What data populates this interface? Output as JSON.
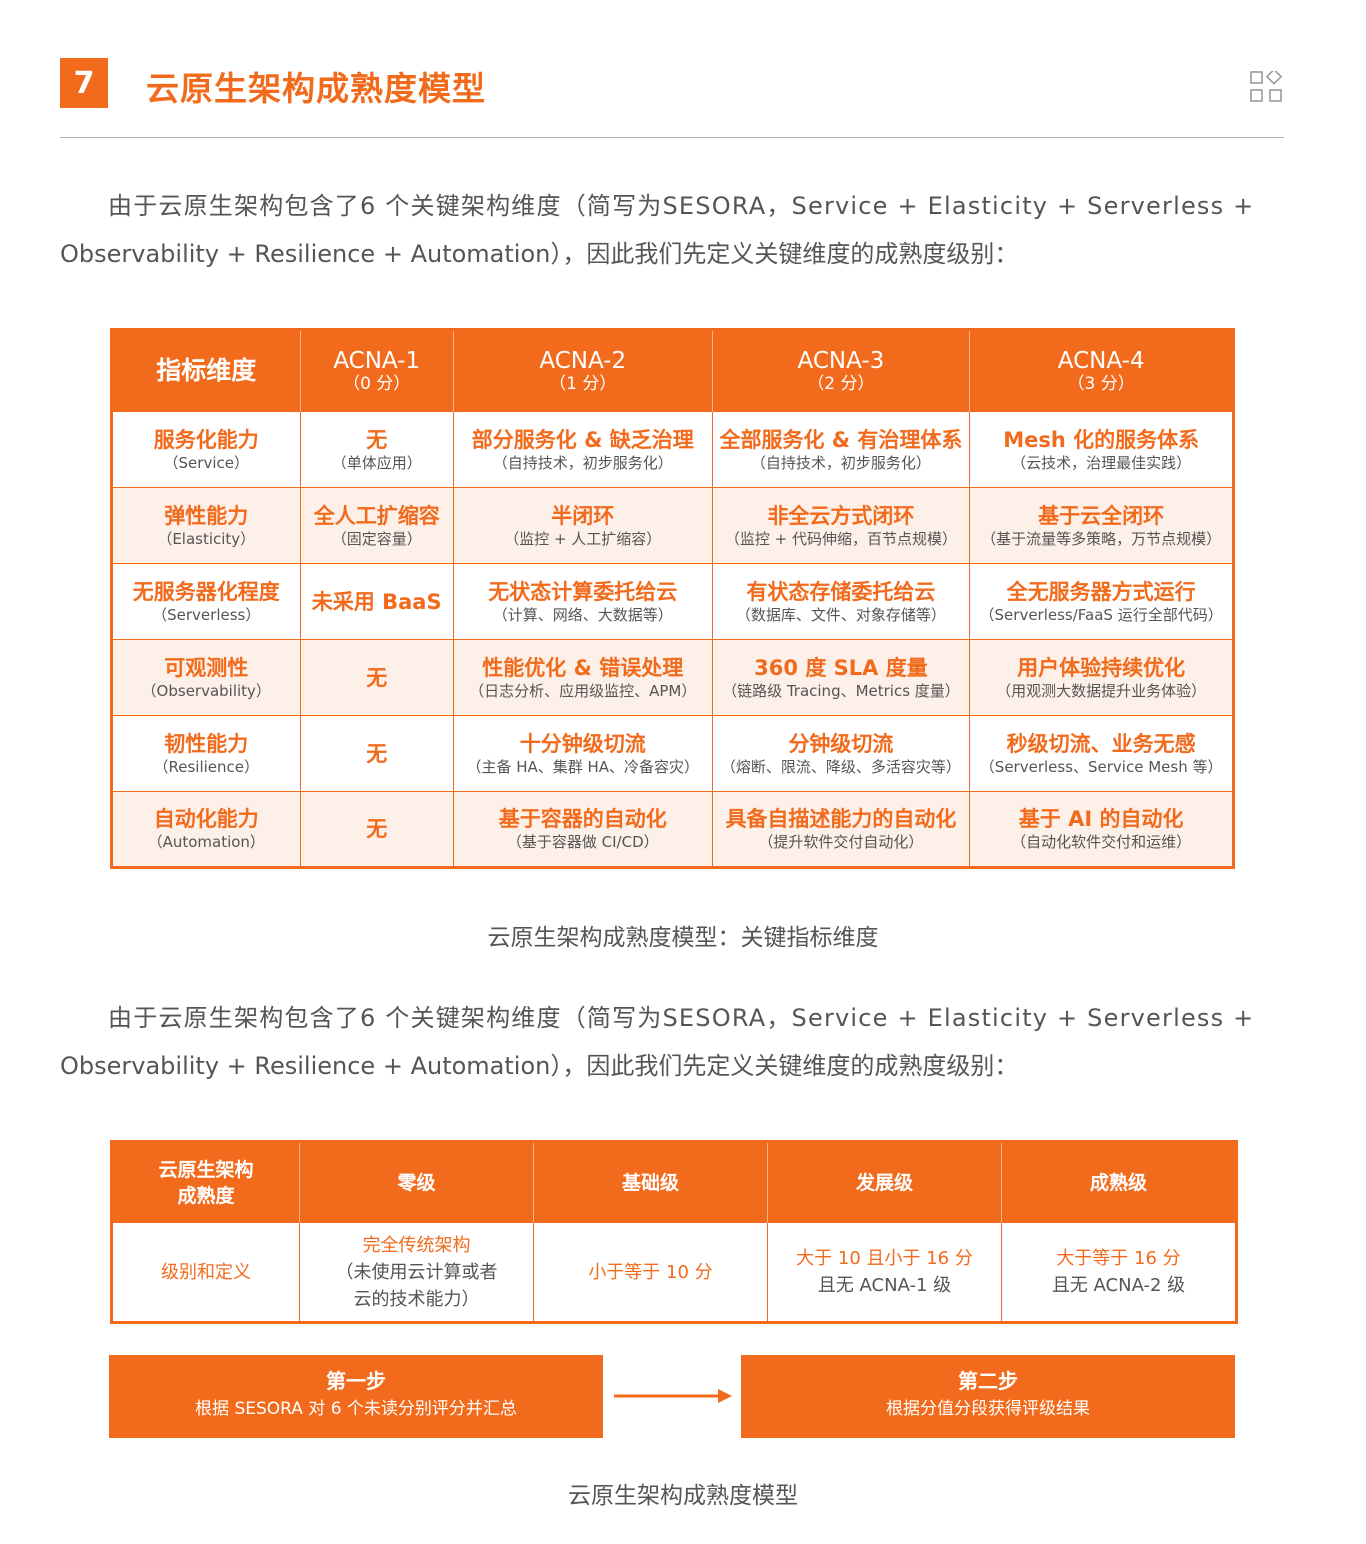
{
  "header": {
    "chapter_number": "7",
    "title": "云原生架构成熟度模型"
  },
  "paragraph1": {
    "line1": "由于云原生架构包含了6 个关键架构维度（简写为SESORA，Service + Elasticity + Serverless +",
    "line2": "Observability + Resilience + Automation），因此我们先定义关键维度的成熟度级别："
  },
  "table1": {
    "headers": [
      {
        "main": "指标维度",
        "sub": ""
      },
      {
        "main": "ACNA-1",
        "sub": "（0 分）"
      },
      {
        "main": "ACNA-2",
        "sub": "（1 分）"
      },
      {
        "main": "ACNA-3",
        "sub": "（2 分）"
      },
      {
        "main": "ACNA-4",
        "sub": "（3 分）"
      }
    ],
    "rows": [
      [
        {
          "m": "服务化能力",
          "s": "（Service）"
        },
        {
          "m": "无",
          "s": "（单体应用）"
        },
        {
          "m": "部分服务化 & 缺乏治理",
          "s": "（自持技术，初步服务化）"
        },
        {
          "m": "全部服务化 & 有治理体系",
          "s": "（自持技术，初步服务化）"
        },
        {
          "m": "Mesh 化的服务体系",
          "s": "（云技术，治理最佳实践）"
        }
      ],
      [
        {
          "m": "弹性能力",
          "s": "（Elasticity）"
        },
        {
          "m": "全人工扩缩容",
          "s": "（固定容量）"
        },
        {
          "m": "半闭环",
          "s": "（监控 + 人工扩缩容）"
        },
        {
          "m": "非全云方式闭环",
          "s": "（监控 + 代码伸缩，百节点规模）"
        },
        {
          "m": "基于云全闭环",
          "s": "（基于流量等多策略，万节点规模）"
        }
      ],
      [
        {
          "m": "无服务器化程度",
          "s": "（Serverless）"
        },
        {
          "m": "未采用 BaaS",
          "s": ""
        },
        {
          "m": "无状态计算委托给云",
          "s": "（计算、网络、大数据等）"
        },
        {
          "m": "有状态存储委托给云",
          "s": "（数据库、文件、对象存储等）"
        },
        {
          "m": "全无服务器方式运行",
          "s": "（Serverless/FaaS 运行全部代码）"
        }
      ],
      [
        {
          "m": "可观测性",
          "s": "（Observability）"
        },
        {
          "m": "无",
          "s": ""
        },
        {
          "m": "性能优化 & 错误处理",
          "s": "（日志分析、应用级监控、APM）"
        },
        {
          "m": "360 度 SLA 度量",
          "s": "（链路级 Tracing、Metrics 度量）"
        },
        {
          "m": "用户体验持续优化",
          "s": "（用观测大数据提升业务体验）"
        }
      ],
      [
        {
          "m": "韧性能力",
          "s": "（Resilience）"
        },
        {
          "m": "无",
          "s": ""
        },
        {
          "m": "十分钟级切流",
          "s": "（主备 HA、集群 HA、冷备容灾）"
        },
        {
          "m": "分钟级切流",
          "s": "（熔断、限流、降级、多活容灾等）"
        },
        {
          "m": "秒级切流、业务无感",
          "s": "（Serverless、Service Mesh 等）"
        }
      ],
      [
        {
          "m": "自动化能力",
          "s": "（Automation）"
        },
        {
          "m": "无",
          "s": ""
        },
        {
          "m": "基于容器的自动化",
          "s": "（基于容器做 CI/CD）"
        },
        {
          "m": "具备自描述能力的自动化",
          "s": "（提升软件交付自动化）"
        },
        {
          "m": "基于 AI 的自动化",
          "s": "（自动化软件交付和运维）"
        }
      ]
    ]
  },
  "caption1": "云原生架构成熟度模型：关键指标维度",
  "paragraph2": {
    "line1": "由于云原生架构包含了6 个关键架构维度（简写为SESORA，Service + Elasticity + Serverless +",
    "line2": "Observability + Resilience + Automation），因此我们先定义关键维度的成熟度级别："
  },
  "table2": {
    "headers": [
      "云原生架构\n成熟度",
      "零级",
      "基础级",
      "发展级",
      "成熟级"
    ],
    "header0_line1": "云原生架构",
    "header0_line2": "成熟度",
    "row_label": "级别和定义",
    "cells": {
      "zero_l1": "完全传统架构",
      "zero_l2": "（未使用云计算或者",
      "zero_l3": "云的技术能力）",
      "basic": "小于等于 10 分",
      "dev_l1": "大于 10 且小于 16 分",
      "dev_l2": "且无 ACNA-1 级",
      "mature_l1": "大于等于 16 分",
      "mature_l2": "且无 ACNA-2 级"
    }
  },
  "steps": {
    "step1_title": "第一步",
    "step1_desc": "根据 SESORA 对 6 个未读分别评分并汇总",
    "step2_title": "第二步",
    "step2_desc": "根据分值分段获得评级结果"
  },
  "caption2": "云原生架构成熟度模型",
  "colors": {
    "accent": "#f26b1d",
    "row_tint": "#fdf0e8",
    "text": "#555555",
    "rule": "#b5b5b5"
  },
  "icons": {
    "header_icon": "grid-diamond-icon",
    "flow_arrow": "right-arrow-icon"
  }
}
